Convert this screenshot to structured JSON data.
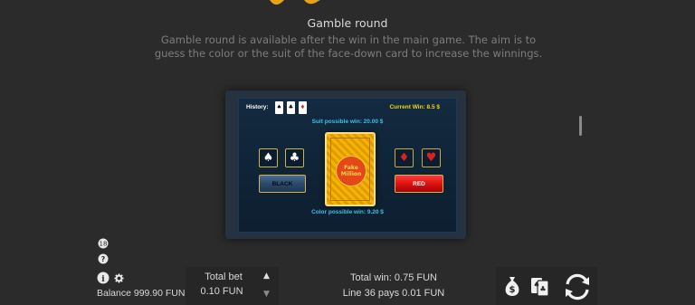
{
  "header": {
    "title": "Gamble round",
    "description": "Gamble round is available after the win in the main game. The aim is to guess the color or the suit of the face-down card to increase the winnings."
  },
  "gamble": {
    "history_label": "History:",
    "history_cards": [
      "♠",
      "♣",
      "♦"
    ],
    "current_win": "Current Win: 8.5 $",
    "suit_possible_win": "Suit possible win: 20.00 $",
    "color_possible_win": "Color possible win: 9.20 $",
    "black_label": "BLACK",
    "red_label": "RED",
    "suits": {
      "spade": "♠",
      "club": "♣",
      "diamond": "♦",
      "heart": "♥"
    },
    "card_logo": "Fake Million"
  },
  "footer": {
    "balance": "Balance 999.90 FUN",
    "total_bet_label": "Total bet",
    "total_bet_value": "0.10 FUN",
    "total_win": "Total win: 0.75 FUN",
    "line_pays": "Line 36 pays 0.01 FUN"
  },
  "colors": {
    "accent_gold": "#f5d31a",
    "info_cyan": "#39c2e6",
    "red_button": "#d90f0f",
    "background": "#2b2b2b"
  },
  "icons": [
    "bonus-icon",
    "help-icon",
    "info-icon",
    "gear-icon",
    "money-bag-icon",
    "gamble-cards-icon",
    "autoplay-icon"
  ]
}
